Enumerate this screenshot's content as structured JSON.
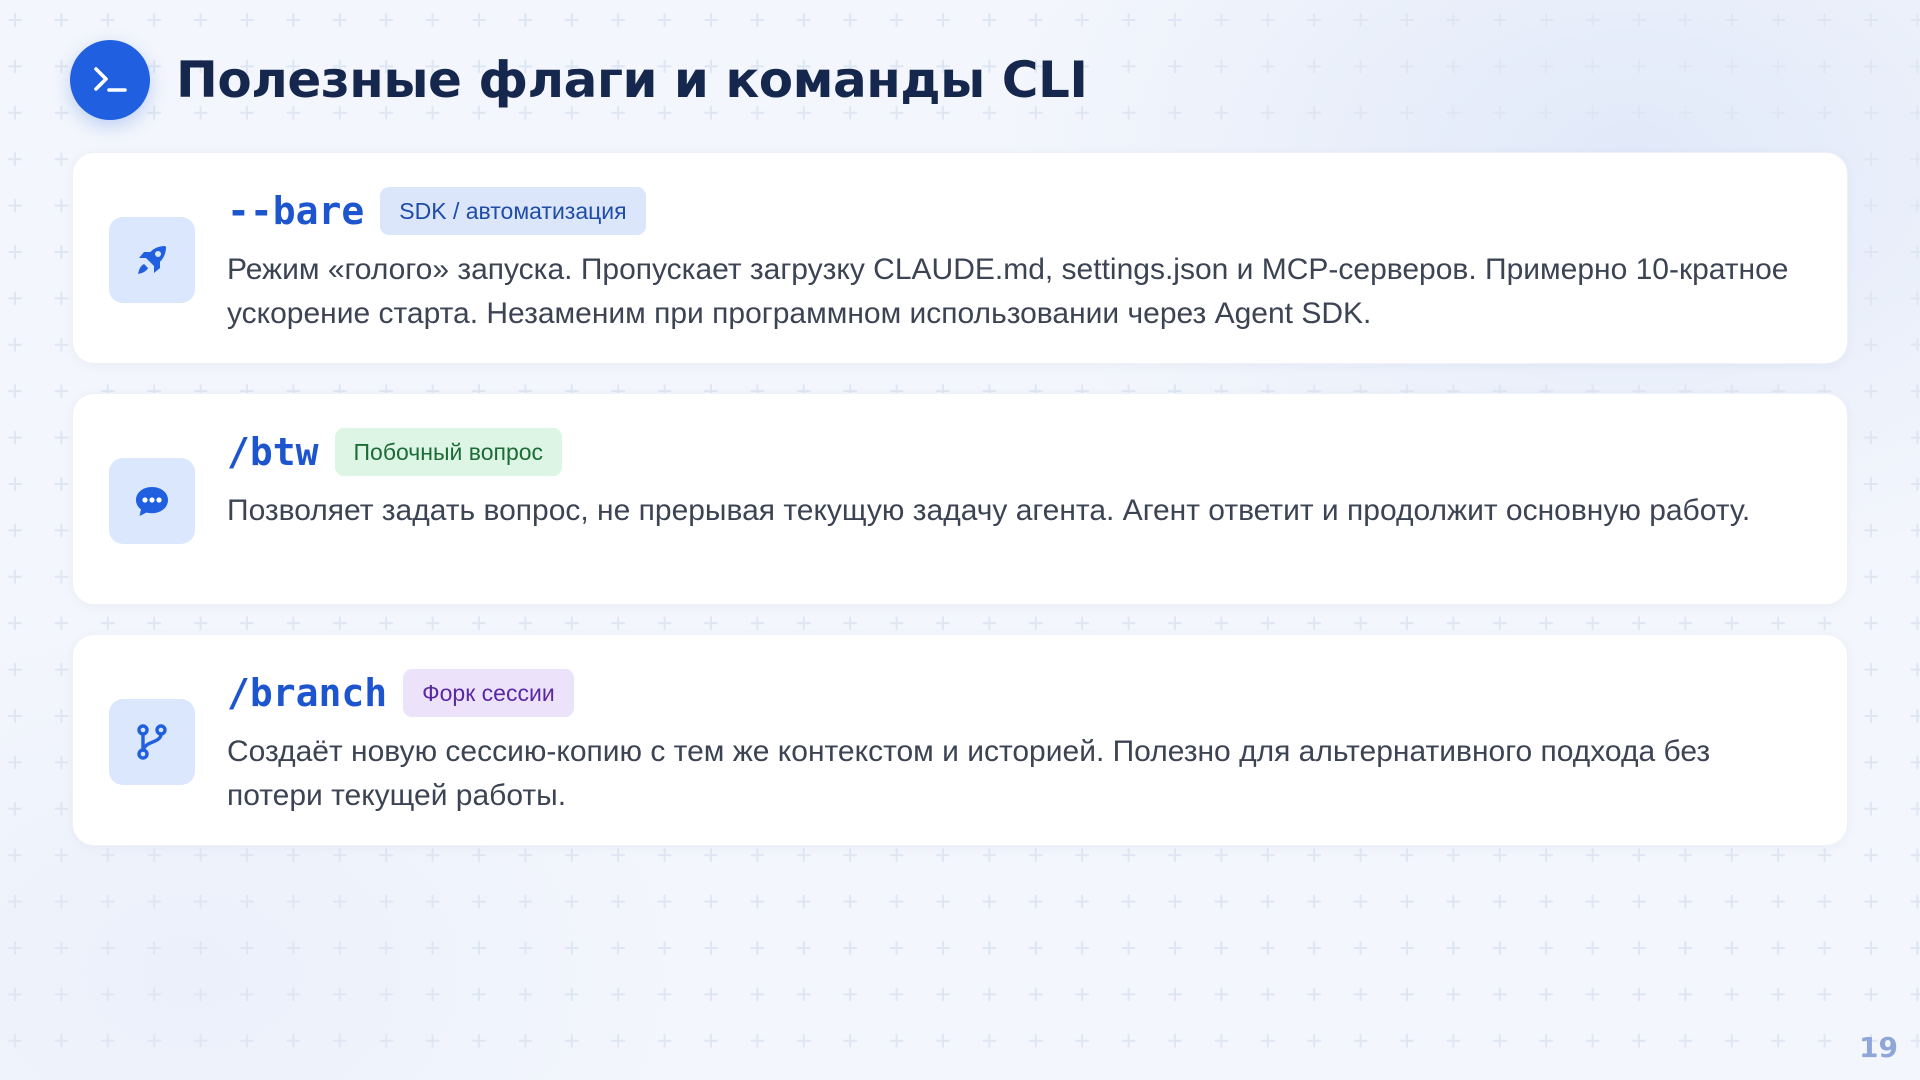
{
  "slide": {
    "title": "Полезные флаги и команды CLI",
    "page_number": "19",
    "icons": {
      "title": "terminal-prompt-icon"
    }
  },
  "cards": [
    {
      "command": "--bare",
      "badge": "SDK / автоматизация",
      "badge_color": "#dbe6fb",
      "icon": "rocket-icon",
      "description": "Режим «голого» запуска. Пропускает загрузку CLAUDE.md, settings.json и MCP-серверов. Примерно 10-кратное ускорение старта. Незаменим при программном использовании через Agent SDK."
    },
    {
      "command": "/btw",
      "badge": "Побочный вопрос",
      "badge_color": "#dcf5e4",
      "icon": "chat-bubble-icon",
      "description": "Позволяет задать вопрос, не прерывая текущую задачу агента. Агент ответит и продолжит основную работу."
    },
    {
      "command": "/branch",
      "badge": "Форк сессии",
      "badge_color": "#ece3fa",
      "icon": "git-branch-icon",
      "description": "Создаёт новую сессию-копию с тем же контекстом и историей. Полезно для альтернативного подхода без потери текущей работы."
    }
  ],
  "colors": {
    "accent": "#1f5fe0",
    "command_text": "#1d55cf",
    "title_text": "#16274d",
    "body_text": "#3c4454"
  }
}
